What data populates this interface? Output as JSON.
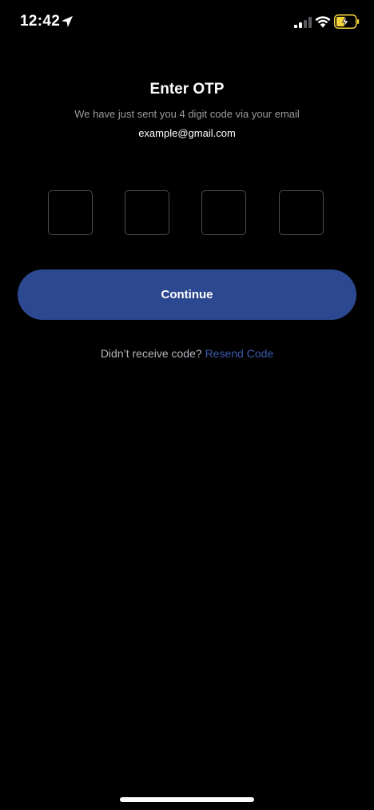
{
  "status_bar": {
    "time": "12:42",
    "icons": [
      "location-arrow-icon",
      "cellular-signal-icon",
      "wifi-icon",
      "battery-charging-icon"
    ],
    "battery_color": "#f5d33b"
  },
  "screen": {
    "title": "Enter OTP",
    "subtitle": "We have just sent you 4 digit code via your email",
    "email": "example@gmail.com"
  },
  "otp": {
    "digits": [
      "",
      "",
      "",
      ""
    ]
  },
  "continue_button": {
    "label": "Continue",
    "color": "#2c4890"
  },
  "resend": {
    "prompt": "Didn’t receive code?",
    "link_label": "Resend Code",
    "link_color": "#3b5aad"
  }
}
